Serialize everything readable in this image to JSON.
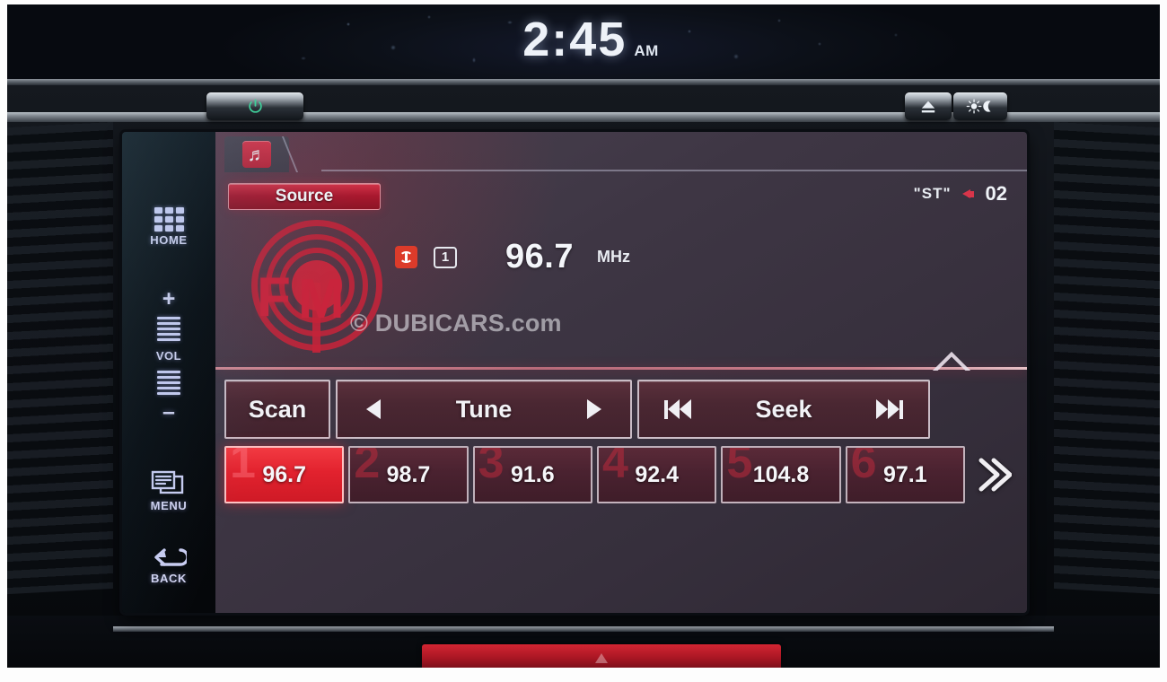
{
  "dashboard": {
    "clock": {
      "time": "2:45",
      "ampm": "AM"
    }
  },
  "bezel": {
    "buttons": [
      {
        "name": "power",
        "icon": "power-icon",
        "label": ""
      },
      {
        "name": "eject",
        "icon": "eject-icon",
        "label": ""
      },
      {
        "name": "day-night",
        "icon": "sun-moon-icon",
        "label": ""
      }
    ]
  },
  "hardkeys": {
    "home": {
      "label": "HOME",
      "icon": "grid-icon"
    },
    "volume": {
      "label": "VOL",
      "plus": "+",
      "minus": "–",
      "icon": "volume-slider-icon"
    },
    "menu": {
      "label": "MENU",
      "icon": "menu-panels-icon"
    },
    "back": {
      "label": "BACK",
      "icon": "back-arrow-icon"
    }
  },
  "screen": {
    "tab": {
      "icon": "music-note-icon",
      "glyph": "♬"
    },
    "source_button": "Source",
    "status": {
      "stereo": "ʺSTʺ",
      "speaker_icon": "speaker-icon",
      "volume": "02"
    },
    "band": {
      "logo_f": "F",
      "logo_m": "M",
      "name": "FM"
    },
    "now_playing": {
      "rds_icon": "rds-broadcast-icon",
      "preset_indicator": "1",
      "frequency": "96.7",
      "unit": "MHz"
    },
    "watermark": "© DUBICARS.com",
    "controls": [
      {
        "name": "scan",
        "label": "Scan",
        "left_icon": "",
        "right_icon": ""
      },
      {
        "name": "tune",
        "label": "Tune",
        "left_icon": "triangle-left-icon",
        "right_icon": "triangle-right-icon"
      },
      {
        "name": "seek",
        "label": "Seek",
        "left_icon": "skip-previous-icon",
        "right_icon": "skip-next-icon"
      }
    ],
    "presets": [
      {
        "number": "1",
        "frequency": "96.7",
        "active": true
      },
      {
        "number": "2",
        "frequency": "98.7",
        "active": false
      },
      {
        "number": "3",
        "frequency": "91.6",
        "active": false
      },
      {
        "number": "4",
        "frequency": "92.4",
        "active": false
      },
      {
        "number": "5",
        "frequency": "104.8",
        "active": false
      },
      {
        "number": "6",
        "frequency": "97.1",
        "active": false
      }
    ],
    "preset_next_icon": "double-chevron-right-icon",
    "expand_handle_icon": "chevron-up-icon"
  },
  "colors": {
    "accent_red": "#c9243c",
    "active_preset": "#e2222e",
    "screen_bg": "#3e3644",
    "key_text": "#d3d4f2"
  }
}
